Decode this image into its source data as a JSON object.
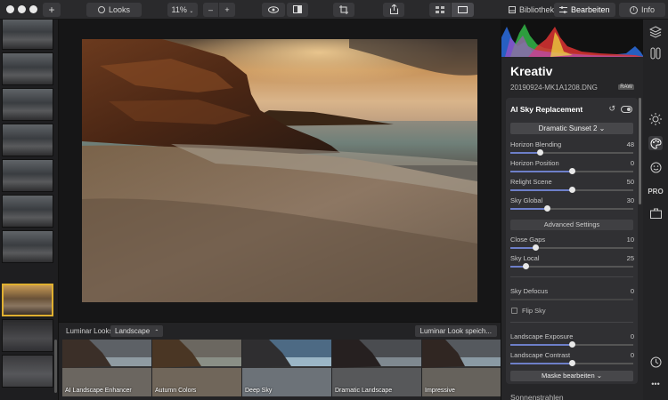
{
  "toolbar": {
    "add_icon": "plus",
    "looks_label": "Looks",
    "zoom": "11%",
    "minus": "–",
    "plus": "+",
    "tabs": [
      {
        "label": "Bibliothek",
        "icon": "library-icon",
        "active": false
      },
      {
        "label": "Bearbeiten",
        "icon": "sliders-icon",
        "active": true
      },
      {
        "label": "Info",
        "icon": "info-icon",
        "active": false
      }
    ]
  },
  "filmstrip": {
    "selected_index": 7,
    "count": 10
  },
  "looks": {
    "label": "Luminar Looks:",
    "category": "Landscape",
    "category_arrow": "⌃",
    "save_label": "Luminar Look speich...",
    "items": [
      {
        "name": "AI Landscape Enhancer"
      },
      {
        "name": "Autumn Colors"
      },
      {
        "name": "Deep Sky"
      },
      {
        "name": "Dramatic Landscape"
      },
      {
        "name": "Impressive"
      }
    ]
  },
  "panel": {
    "title": "Kreativ",
    "filename": "20190924-MK1A1208.DNG",
    "raw_badge": "RAW",
    "tool": {
      "name": "AI Sky Replacement",
      "preset": "Dramatic Sunset 2 ⌄",
      "advanced_label": "Advanced Settings",
      "flip_sky_label": "Flip Sky",
      "mask_label": "Maske bearbeiten ⌄",
      "sliders": [
        {
          "label": "Horizon Blending",
          "value": "48",
          "fraction": 0.24
        },
        {
          "label": "Horizon Position",
          "value": "0",
          "fraction": 0.5
        },
        {
          "label": "Relight Scene",
          "value": "50",
          "fraction": 0.5
        },
        {
          "label": "Sky Global",
          "value": "30",
          "fraction": 0.3
        },
        {
          "label": "Close Gaps",
          "value": "10",
          "fraction": 0.2
        },
        {
          "label": "Sky Local",
          "value": "25",
          "fraction": 0.12
        },
        {
          "label": "Sky Defocus",
          "value": "0",
          "fraction": 0.0
        },
        {
          "label": "Landscape Exposure",
          "value": "0",
          "fraction": 0.5
        },
        {
          "label": "Landscape Contrast",
          "value": "0",
          "fraction": 0.5
        }
      ]
    },
    "next_section": "Sonnenstrahlen"
  },
  "rail": {
    "icons": [
      "layers-icon",
      "palette-icon",
      "smiley-icon",
      "pro-icon",
      "briefcase-icon",
      "history-icon",
      "more-icon"
    ],
    "pro_label": "PRO",
    "more_label": "•••"
  }
}
